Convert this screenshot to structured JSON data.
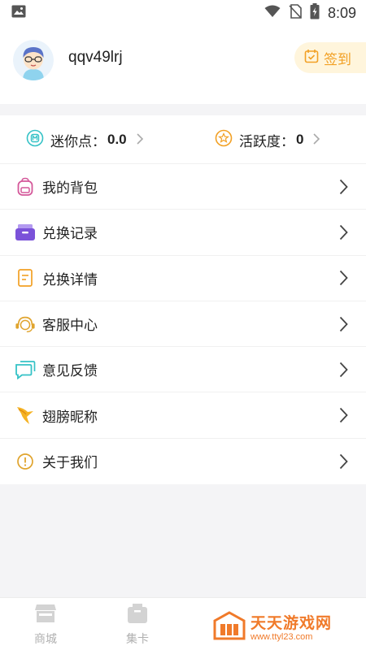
{
  "status_bar": {
    "time": "8:09"
  },
  "profile": {
    "username": "qqv49lrj",
    "checkin_label": "签到"
  },
  "stats": {
    "mini_points": {
      "label": "迷你点：",
      "value": "0.0"
    },
    "activity": {
      "label": "活跃度：",
      "value": "0"
    }
  },
  "menu": {
    "items": [
      {
        "label": "我的背包",
        "icon": "backpack-icon"
      },
      {
        "label": "兑换记录",
        "icon": "box-icon"
      },
      {
        "label": "兑换详情",
        "icon": "document-icon"
      },
      {
        "label": "客服中心",
        "icon": "headset-icon"
      },
      {
        "label": "意见反馈",
        "icon": "chat-bubble-icon"
      },
      {
        "label": "翅膀昵称",
        "icon": "wing-icon"
      },
      {
        "label": "关于我们",
        "icon": "info-icon"
      }
    ]
  },
  "bottom_nav": {
    "tabs": [
      {
        "label": "商城",
        "icon": "shop-icon"
      },
      {
        "label": "集卡",
        "icon": "card-box-icon"
      }
    ]
  },
  "watermark": {
    "title": "天天游戏网",
    "url": "www.ttyl23.com"
  },
  "colors": {
    "accent_orange": "#f2a024",
    "checkin_bg": "#fff5dc",
    "watermark_orange": "#f07a2a",
    "page_bg": "#f4f4f6"
  }
}
